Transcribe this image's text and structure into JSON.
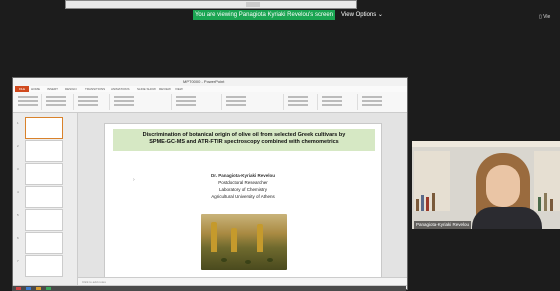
{
  "screen_share": {
    "banner": "You are viewing Panagiota Kyriaki Revelou's screen",
    "view_options": "View Options ⌄",
    "top_right_view": "▯ Vie"
  },
  "powerpoint": {
    "titlebar_title": "MPT0000 - PowerPoint",
    "tabs": [
      "FILE",
      "HOME",
      "INSERT",
      "DESIGN",
      "TRANSITIONS",
      "ANIMATIONS",
      "SLIDE SHOW",
      "REVIEW",
      "VIEW"
    ],
    "slide": {
      "title_line1": "Discrimination of botanical origin of olive oil from selected Greek cultivars by",
      "title_line2": "SPME-GC-MS and ATR-FTIR spectroscopy combined with chemometrics",
      "author_name": "Dr. Panagiota-Kyriaki Revelou",
      "author_role": "Postdoctoral Researcher",
      "author_lab": "Laboratory of Chemistry",
      "author_university": "Agricultural University of Athens"
    },
    "thumbnail_numbers": [
      "1",
      "2",
      "3",
      "4",
      "5",
      "6",
      "7"
    ],
    "notes_placeholder": "Click to add notes"
  },
  "webcam": {
    "participant_label": "Panagiota-Kyriaki Revelou"
  }
}
